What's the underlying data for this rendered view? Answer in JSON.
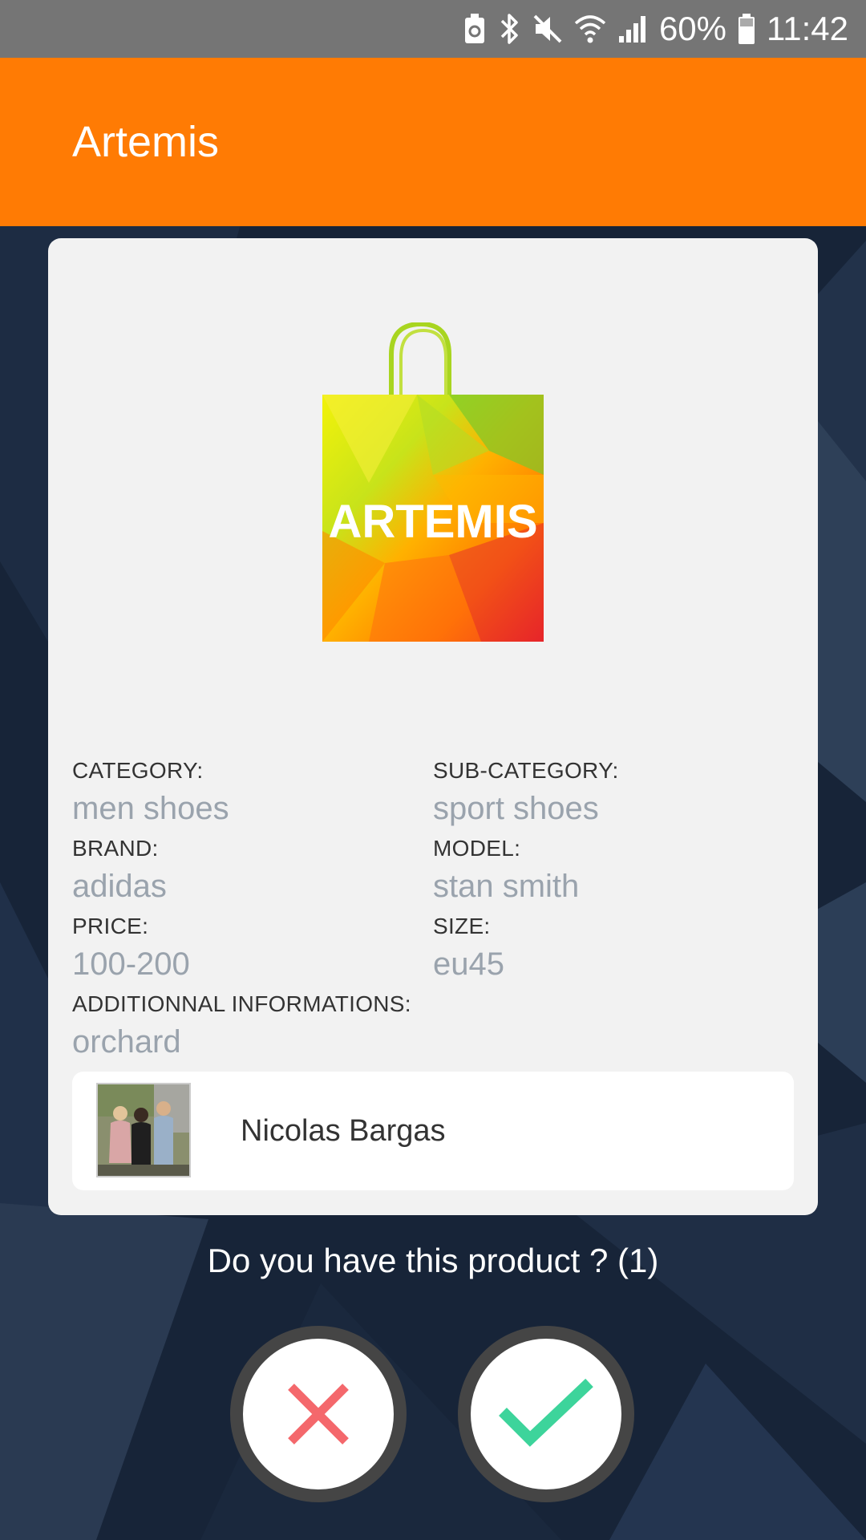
{
  "status_bar": {
    "battery_percent": "60%",
    "time": "11:42",
    "icons": [
      "battery-saver-icon",
      "bluetooth-icon",
      "mute-icon",
      "wifi-icon",
      "signal-icon",
      "battery-icon"
    ]
  },
  "app_bar": {
    "title": "Artemis"
  },
  "product": {
    "logo_text": "ARTEMIS",
    "fields": [
      {
        "label": "CATEGORY:",
        "value": "men shoes"
      },
      {
        "label": "SUB-CATEGORY:",
        "value": "sport shoes"
      },
      {
        "label": "BRAND:",
        "value": "adidas"
      },
      {
        "label": "MODEL:",
        "value": "stan smith"
      },
      {
        "label": "PRICE:",
        "value": "100-200"
      },
      {
        "label": "SIZE:",
        "value": "eu45"
      },
      {
        "label": "ADDITIONNAL INFORMATIONS:",
        "value": "orchard"
      }
    ]
  },
  "seller": {
    "name": "Nicolas Bargas"
  },
  "prompt": {
    "question": "Do you have this product ? (1)"
  },
  "actions": {
    "reject_icon": "close-icon",
    "accept_icon": "checkmark-icon"
  },
  "colors": {
    "app_bar": "#ff7b04",
    "status_bar": "#757575",
    "reject": "#f4686c",
    "accept": "#3dd49b",
    "background": "#172438"
  }
}
